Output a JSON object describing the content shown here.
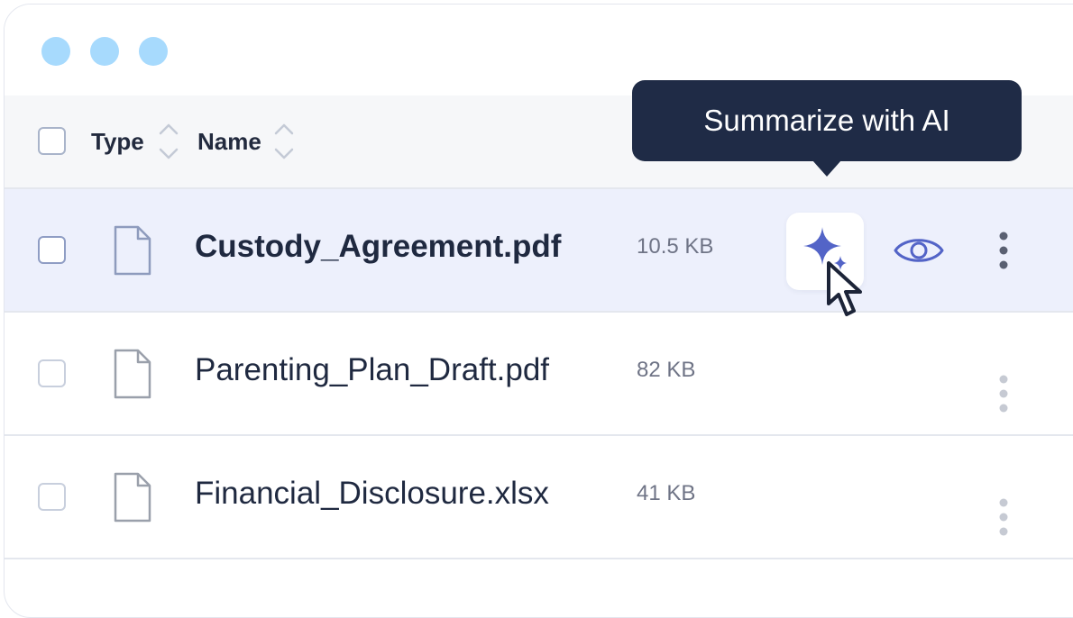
{
  "window": {
    "controls": [
      "window-dot-1",
      "window-dot-2",
      "window-dot-3"
    ],
    "control_color": "#a7dafd"
  },
  "table": {
    "columns": [
      {
        "label": "Type",
        "sortable": true
      },
      {
        "label": "Name",
        "sortable": true
      }
    ],
    "rows": [
      {
        "name": "Custody_Agreement.pdf",
        "size": "10.5 KB",
        "selected": true,
        "file_icon": "document-icon"
      },
      {
        "name": "Parenting_Plan_Draft.pdf",
        "size": "82 KB",
        "selected": false,
        "file_icon": "document-icon"
      },
      {
        "name": "Financial_Disclosure.xlsx",
        "size": "41 KB",
        "selected": false,
        "file_icon": "document-icon"
      }
    ]
  },
  "row_actions": {
    "summarize_icon": "sparkle-icon",
    "preview_icon": "eye-icon",
    "more_icon": "more-vertical-icon"
  },
  "tooltip": {
    "text": "Summarize with AI"
  },
  "colors": {
    "accent": "#5364c7",
    "selected_row_bg": "#edf0fc",
    "tooltip_bg": "#1f2b46",
    "text_primary": "#1f2940",
    "text_secondary": "#6f7486"
  }
}
